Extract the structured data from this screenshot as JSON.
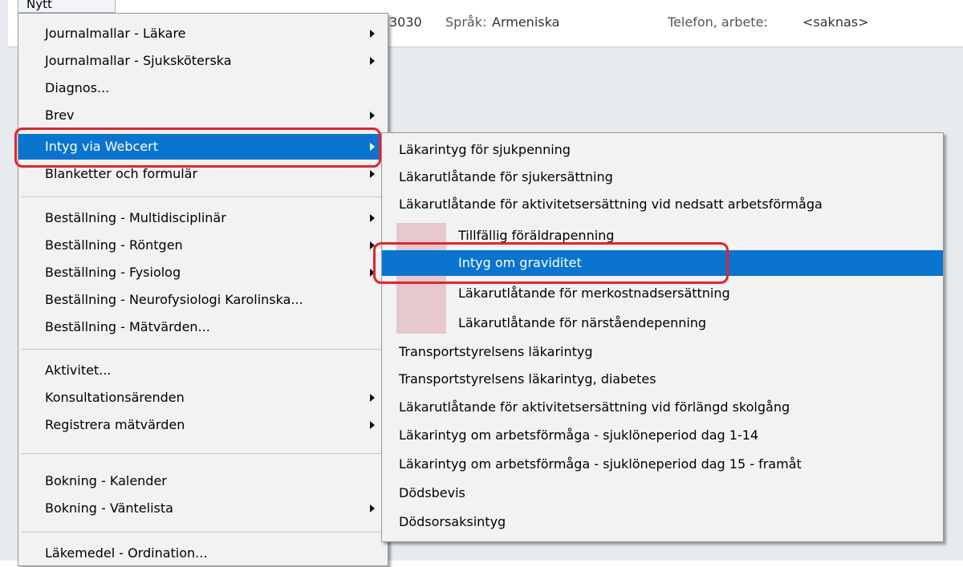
{
  "background": {
    "toolbar_button": "Nytt",
    "patient_code": "3030",
    "language_label": "Språk:",
    "language_value": "Armeniska",
    "phone_label": "Telefon, arbete:",
    "phone_value": "<saknas>"
  },
  "main_menu": {
    "items": [
      {
        "label": "Journalmallar - Läkare",
        "submenu": true
      },
      {
        "label": "Journalmallar - Sjuksköterska",
        "submenu": true
      },
      {
        "label": "Diagnos...",
        "submenu": false
      },
      {
        "label": "Brev",
        "submenu": true
      },
      {
        "label": "Intyg via Webcert",
        "submenu": true,
        "selected": true
      },
      {
        "label": "Blanketter och formulär",
        "submenu": true
      },
      {
        "label": "Beställning - Multidisciplinär",
        "submenu": true
      },
      {
        "label": "Beställning - Röntgen",
        "submenu": true
      },
      {
        "label": "Beställning - Fysiolog",
        "submenu": true
      },
      {
        "label": "Beställning - Neurofysiologi Karolinska...",
        "submenu": false
      },
      {
        "label": "Beställning - Mätvärden...",
        "submenu": false
      },
      {
        "label": "Aktivitet...",
        "submenu": false
      },
      {
        "label": "Konsultationsärenden",
        "submenu": true
      },
      {
        "label": "Registrera mätvärden",
        "submenu": true
      },
      {
        "label": "Bokning - Kalender",
        "submenu": false
      },
      {
        "label": "Bokning - Väntelista",
        "submenu": true
      },
      {
        "label": "Läkemedel - Ordination...",
        "submenu": false
      }
    ]
  },
  "sub_menu": {
    "items": [
      {
        "label": "Läkarintyg för sjukpenning"
      },
      {
        "label": "Läkarutlåtande för sjukersättning"
      },
      {
        "label": "Läkarutlåtande för aktivitetsersättning vid nedsatt arbetsförmåga"
      },
      {
        "label": "Tillfällig föräldrapenning",
        "indent": true
      },
      {
        "label": "Intyg om graviditet",
        "indent": true,
        "selected": true
      },
      {
        "label": "Läkarutlåtande för merkostnadsersättning",
        "indent": true
      },
      {
        "label": "Läkarutlåtande för närståendepenning",
        "indent": true
      },
      {
        "label": "Transportstyrelsens läkarintyg"
      },
      {
        "label": "Transportstyrelsens läkarintyg, diabetes"
      },
      {
        "label": "Läkarutlåtande för aktivitetsersättning vid förlängd skolgång"
      },
      {
        "label": "Läkarintyg om arbetsförmåga - sjuklöneperiod dag 1-14"
      },
      {
        "label": "Läkarintyg om arbetsförmåga - sjuklöneperiod dag 15 - framåt"
      },
      {
        "label": "Dödsbevis"
      },
      {
        "label": "Dödsorsaksintyg"
      }
    ]
  },
  "colors": {
    "highlight": "#0a74cf",
    "annotation_ring": "#e0252f",
    "menu_bg": "#f2f2f2"
  }
}
